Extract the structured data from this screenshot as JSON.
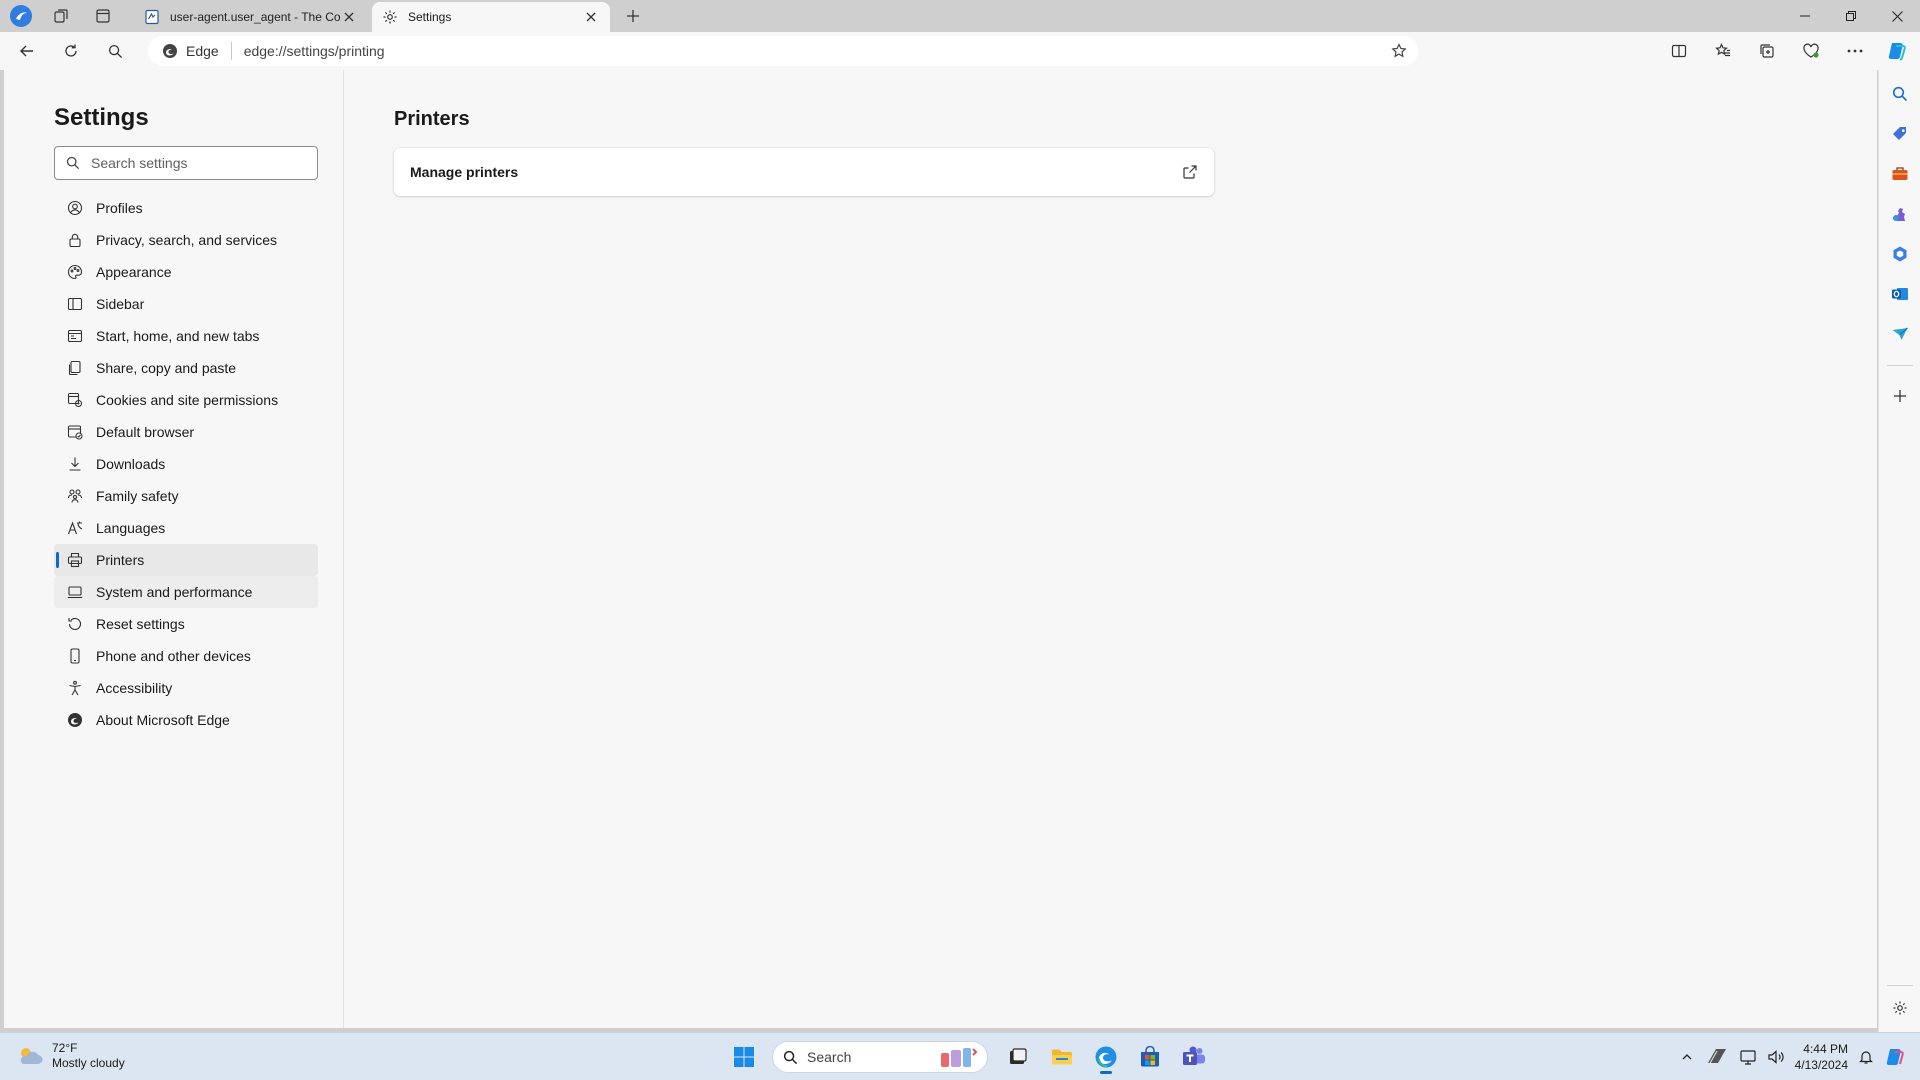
{
  "tabs": [
    {
      "title": "user-agent.user_agent - The Coll",
      "active": false
    },
    {
      "title": "Settings",
      "active": true
    }
  ],
  "toolbar": {
    "site_badge": "Edge",
    "url": "edge://settings/printing"
  },
  "settings_nav": {
    "title": "Settings",
    "search_placeholder": "Search settings",
    "items": [
      {
        "label": "Profiles",
        "icon": "profile-icon"
      },
      {
        "label": "Privacy, search, and services",
        "icon": "lock-icon"
      },
      {
        "label": "Appearance",
        "icon": "appearance-icon"
      },
      {
        "label": "Sidebar",
        "icon": "sidebar-icon"
      },
      {
        "label": "Start, home, and new tabs",
        "icon": "home-tabs-icon"
      },
      {
        "label": "Share, copy and paste",
        "icon": "share-icon"
      },
      {
        "label": "Cookies and site permissions",
        "icon": "cookies-icon"
      },
      {
        "label": "Default browser",
        "icon": "default-browser-icon"
      },
      {
        "label": "Downloads",
        "icon": "download-icon"
      },
      {
        "label": "Family safety",
        "icon": "family-icon"
      },
      {
        "label": "Languages",
        "icon": "languages-icon"
      },
      {
        "label": "Printers",
        "icon": "printer-icon",
        "selected": true
      },
      {
        "label": "System and performance",
        "icon": "system-icon",
        "hover": true
      },
      {
        "label": "Reset settings",
        "icon": "reset-icon"
      },
      {
        "label": "Phone and other devices",
        "icon": "phone-icon"
      },
      {
        "label": "Accessibility",
        "icon": "accessibility-icon"
      },
      {
        "label": "About Microsoft Edge",
        "icon": "edge-logo-icon"
      }
    ]
  },
  "main": {
    "title": "Printers",
    "card_label": "Manage printers"
  },
  "taskbar": {
    "temperature": "72°F",
    "weather_desc": "Mostly cloudy",
    "search_label": "Search",
    "time": "4:44 PM",
    "date": "4/13/2024"
  },
  "colors": {
    "accent": "#0f6cbd",
    "page_bg": "#f7f7f7",
    "tabstrip_bg": "#cfcfcf",
    "taskbar_bg": "#dce6f2"
  }
}
